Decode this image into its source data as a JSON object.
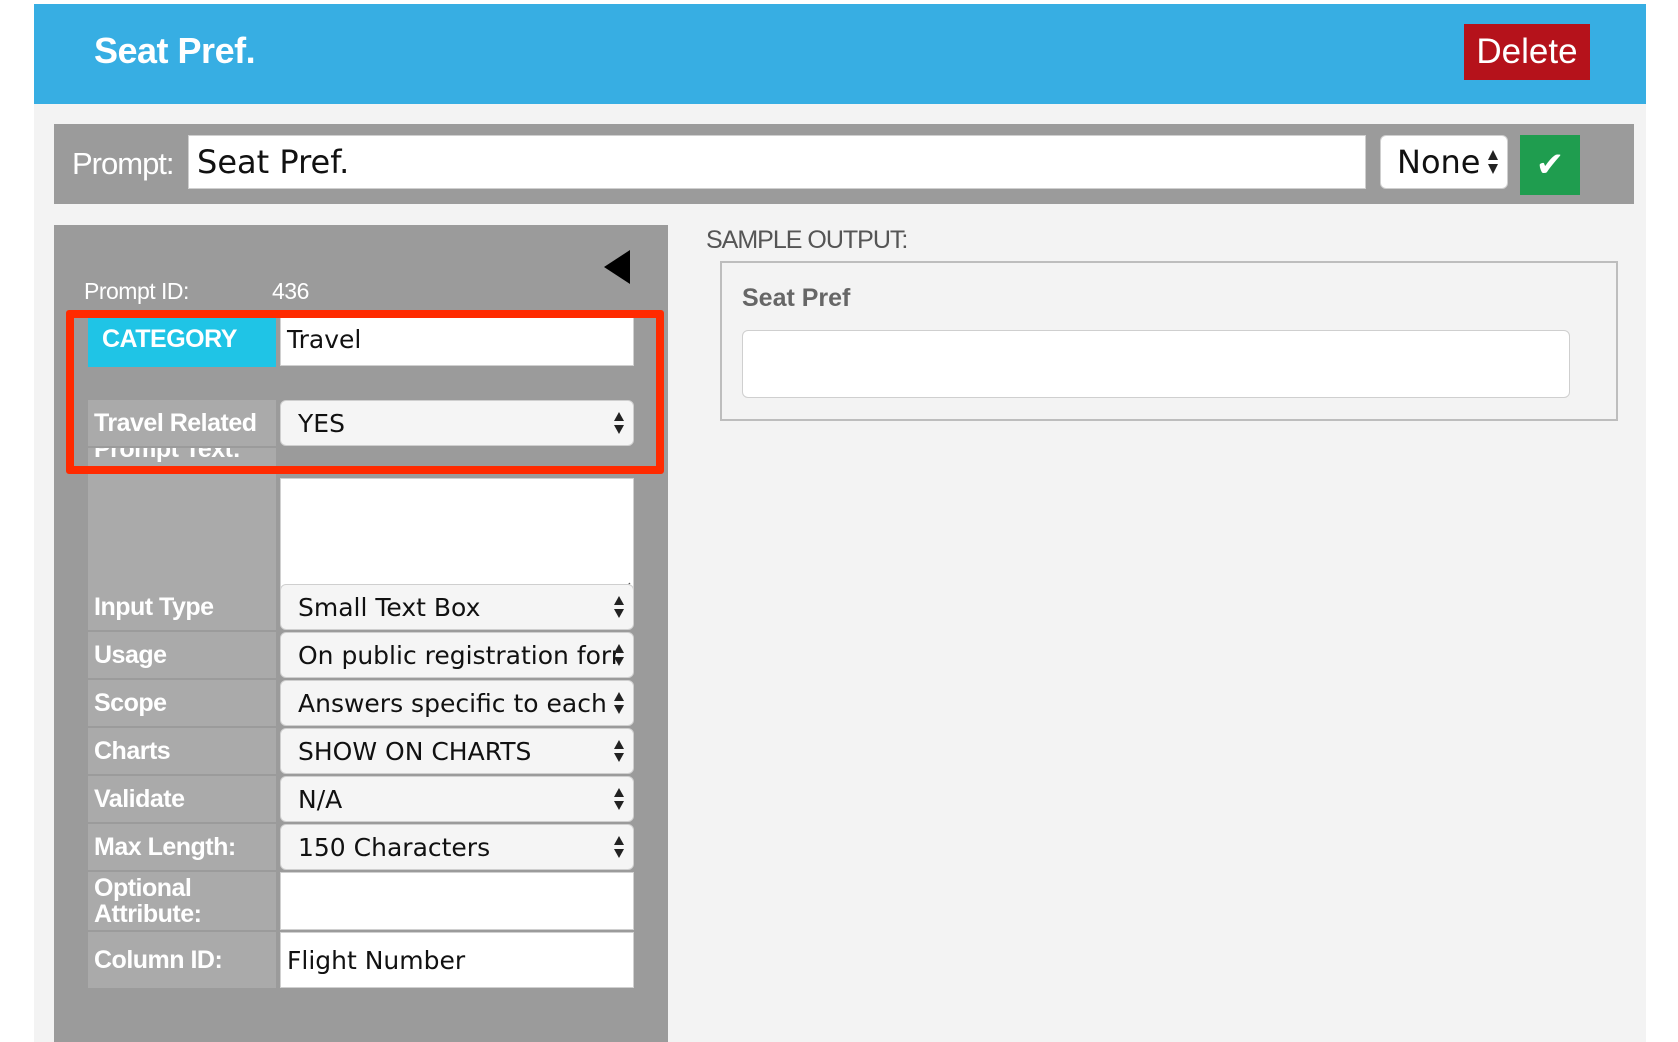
{
  "header": {
    "title": "Seat Pref.",
    "delete_label": "Delete"
  },
  "prompt_bar": {
    "label": "Prompt:",
    "value": "Seat Pref.",
    "select_value": "None",
    "confirm_icon": "✔"
  },
  "details": {
    "prompt_id_label": "Prompt ID:",
    "prompt_id_value": "436",
    "category": {
      "label": "CATEGORY",
      "value": "Travel"
    },
    "travel_related": {
      "label": "Travel Related",
      "value": "YES"
    },
    "prompt_text": {
      "label": "Prompt Text:",
      "value": ""
    },
    "input_type": {
      "label": "Input Type",
      "value": "Small Text Box"
    },
    "usage": {
      "label": "Usage",
      "value": "On public registration form"
    },
    "scope": {
      "label": "Scope",
      "value": "Answers specific to each e"
    },
    "charts": {
      "label": "Charts",
      "value": "SHOW ON CHARTS"
    },
    "validate": {
      "label": "Validate",
      "value": "N/A"
    },
    "max_length": {
      "label": "Max Length:",
      "value": "150 Characters"
    },
    "optional_attribute": {
      "label": "Optional Attribute:",
      "value": ""
    },
    "column_id": {
      "label": "Column ID:",
      "value": "Flight Number"
    }
  },
  "sample_output": {
    "label": "SAMPLE OUTPUT:",
    "field_title": "Seat Pref",
    "field_value": ""
  },
  "colors": {
    "header": "#37aee3",
    "delete": "#b5121b",
    "confirm": "#1f9d4f",
    "category_highlight": "#1fc4e6",
    "annotation": "#ff2a00"
  }
}
